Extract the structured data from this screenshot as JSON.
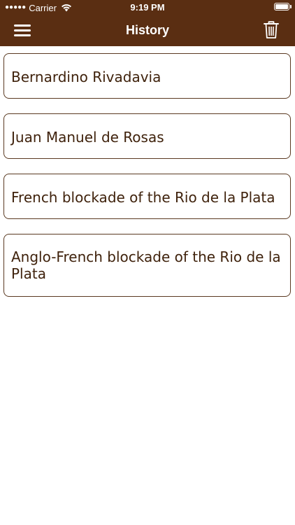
{
  "status_bar": {
    "carrier": "Carrier",
    "time": "9:19 PM"
  },
  "nav": {
    "title": "History",
    "menu_icon": "hamburger-menu-icon",
    "trash_icon": "trash-icon"
  },
  "history_items": [
    {
      "label": "Bernardino Rivadavia"
    },
    {
      "label": "Juan Manuel de Rosas"
    },
    {
      "label": "French blockade of the Rio de la Plata"
    },
    {
      "label": "Anglo-French blockade of the Rio de la Plata"
    }
  ],
  "colors": {
    "bar_background": "#5a2e12",
    "card_text": "#3f220c",
    "card_border": "#5a3a22"
  }
}
